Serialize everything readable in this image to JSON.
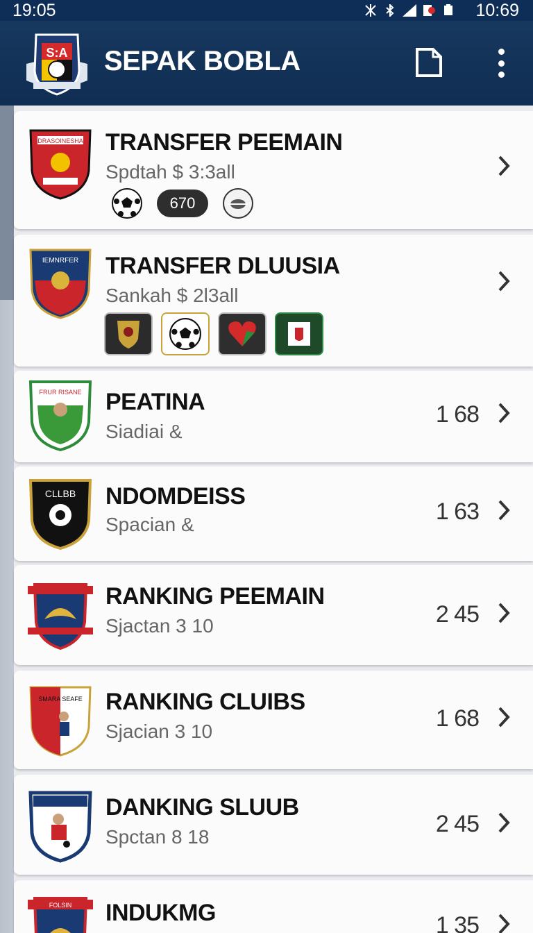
{
  "status_bar": {
    "time_left": "19:05",
    "time_right": "10:69"
  },
  "app_bar": {
    "logo_text": "S:A",
    "title": "SEPAK BOBLA"
  },
  "items": [
    {
      "title": "TRANSFER PEEMAIN",
      "subtitle": "Spdtah $ 3:3all",
      "value": "",
      "crest_text": "IDRASOINESHAI",
      "badge_label": "670"
    },
    {
      "title": "TRANSFER DLUUSIA",
      "subtitle": "Sankah $ 2l3all",
      "value": "",
      "crest_text": "IEMNRFER"
    },
    {
      "title": "PEATINA",
      "subtitle": "Siadiai &",
      "value": "1 68",
      "crest_text": "FRUR RISANE"
    },
    {
      "title": "NDOMDEISS",
      "subtitle": "Spacian &",
      "value": "1 63",
      "crest_text": "CLLBB"
    },
    {
      "title": "RANKING PEEMAIN",
      "subtitle": "Sjactan 3 10",
      "value": "2 45",
      "crest_text": ""
    },
    {
      "title": "RANKING CLUIBS",
      "subtitle": "Sjacian 3 10",
      "value": "1 68",
      "crest_text": "SMARA SEAFE"
    },
    {
      "title": "DANKING SLUUB",
      "subtitle": "Spctan 8 18",
      "value": "2 45",
      "crest_text": ""
    },
    {
      "title": "INDUKMG",
      "subtitle": "",
      "value": "1 35",
      "crest_text": "FOLSIN"
    }
  ],
  "colors": {
    "appbar": "#17385f",
    "card": "#fbfbfb",
    "accent_red": "#d42a2a",
    "navy": "#1a3a73"
  }
}
